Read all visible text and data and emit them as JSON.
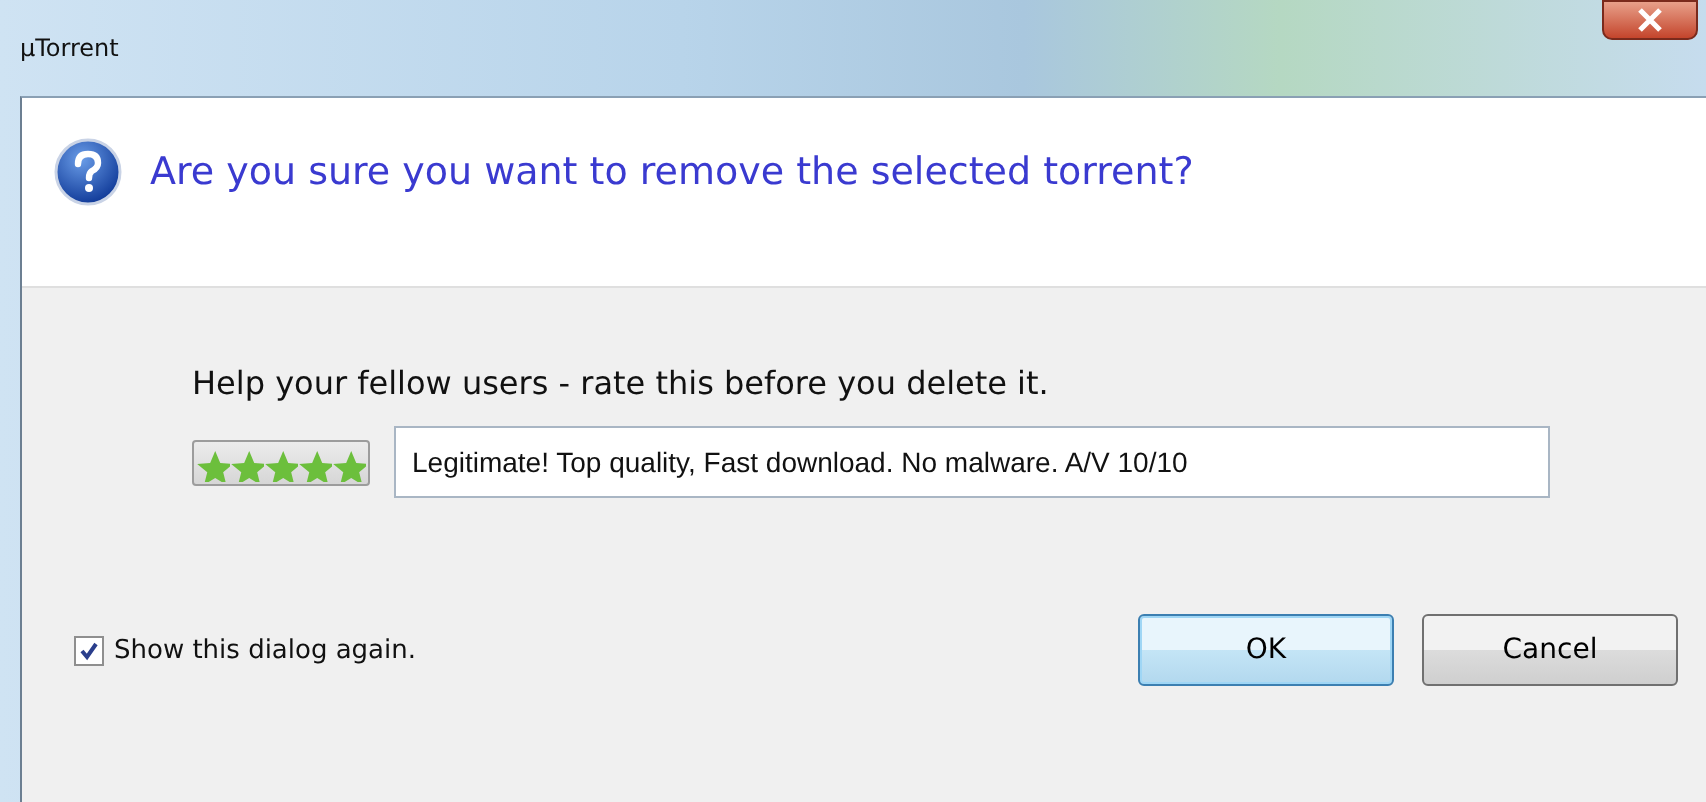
{
  "window": {
    "title": "µTorrent"
  },
  "message": "Are you sure you want to remove the selected torrent?",
  "rating": {
    "prompt": "Help your fellow users - rate this before you delete it.",
    "stars": 5,
    "comment": "Legitimate! Top quality, Fast download. No malware. A/V 10/10"
  },
  "show_again": {
    "label": "Show this dialog again.",
    "checked": true
  },
  "buttons": [
    {
      "label": "OK",
      "default": true
    },
    {
      "label": "Cancel",
      "default": false
    }
  ]
}
